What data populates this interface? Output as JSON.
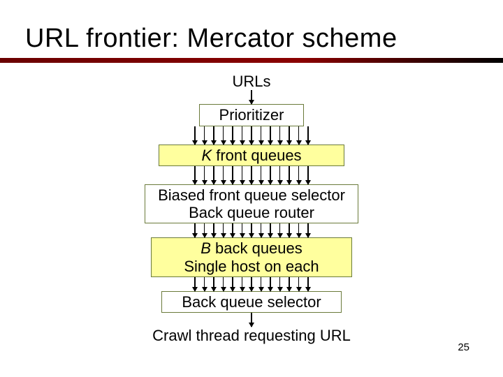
{
  "title": "URL frontier: Mercator scheme",
  "diagram": {
    "input_label": "URLs",
    "prioritizer": "Prioritizer",
    "front_queues_prefix": "K",
    "front_queues_rest": " front queues",
    "selector_router_line1": "Biased front queue selector",
    "selector_router_line2": "Back queue router",
    "back_queues_prefix": "B",
    "back_queues_rest": " back queues",
    "back_queues_line2": "Single host on each",
    "back_selector": "Back queue selector",
    "output_label": "Crawl thread requesting URL"
  },
  "page_number": "25"
}
